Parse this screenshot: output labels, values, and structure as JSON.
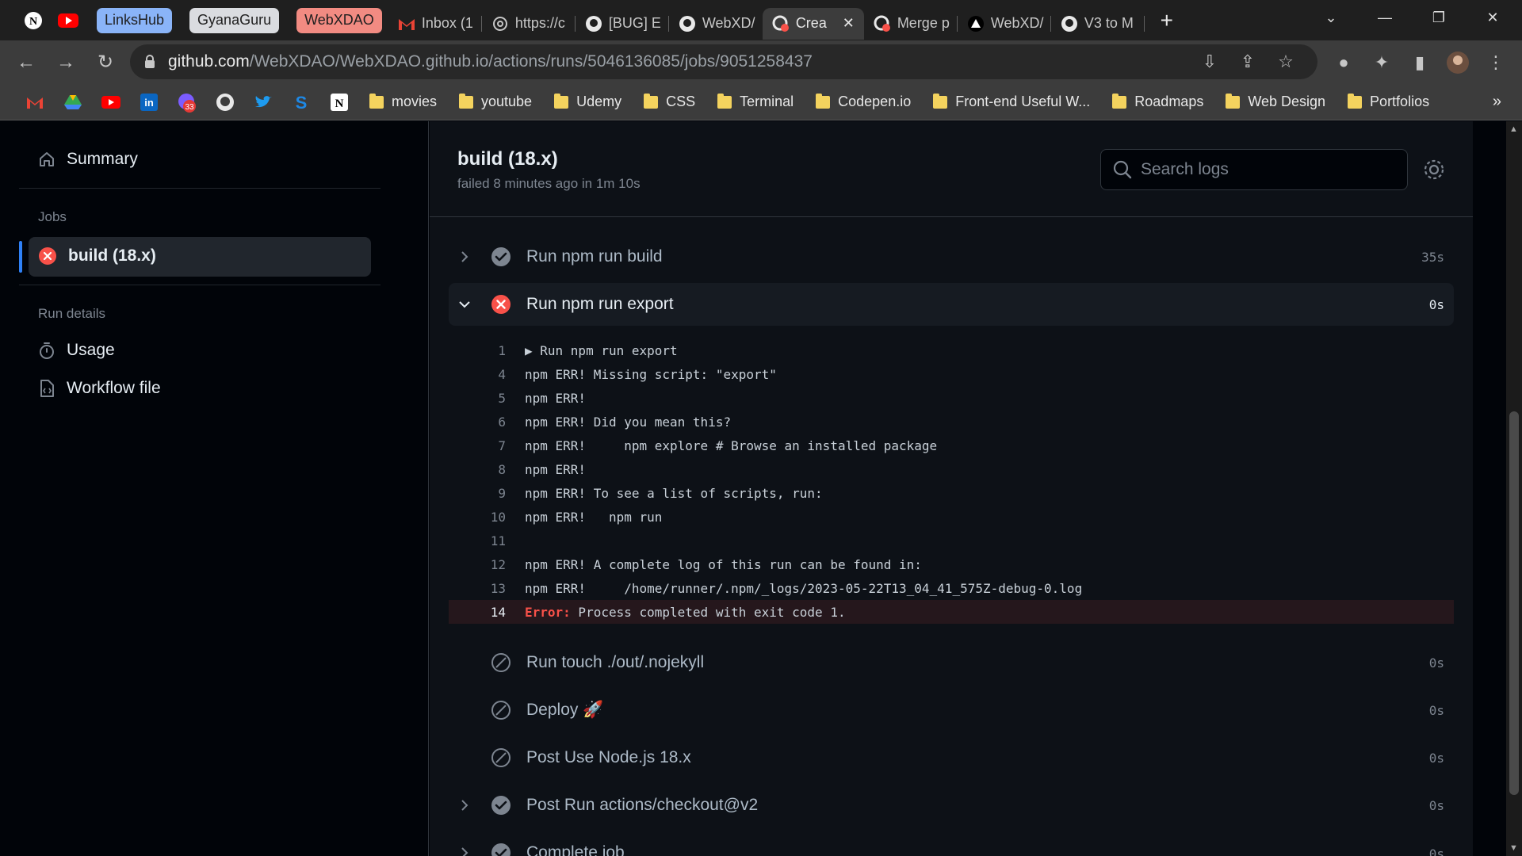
{
  "browser": {
    "groups": [
      "LinksHub",
      "GyanaGuru",
      "WebXDAO"
    ],
    "group_colors": [
      "#8ab4f8",
      "#dadce0",
      "#f28b82"
    ],
    "tabs": [
      {
        "label": "Inbox (1",
        "icon": "gmail-icon"
      },
      {
        "label": "https://c",
        "icon": "chatgpt-icon"
      },
      {
        "label": "[BUG] E",
        "icon": "github-icon"
      },
      {
        "label": "WebXD/",
        "icon": "github-icon"
      },
      {
        "label": "Crea",
        "icon": "github-actions-failed-icon",
        "active": true
      },
      {
        "label": "Merge p",
        "icon": "github-actions-failed-icon"
      },
      {
        "label": "WebXD/",
        "icon": "vercel-icon"
      },
      {
        "label": "V3 to M",
        "icon": "github-icon"
      }
    ],
    "url_host": "github.com",
    "url_path": "/WebXDAO/WebXDAO.github.io/actions/runs/5046136085/jobs/9051258437",
    "bookmarks": [
      "movies",
      "youtube",
      "Udemy",
      "CSS",
      "Terminal",
      "Codepen.io",
      "Front-end Useful W...",
      "Roadmaps",
      "Web Design",
      "Portfolios"
    ],
    "notif_badge": "33"
  },
  "sidebar": {
    "summary": "Summary",
    "jobs_heading": "Jobs",
    "job": "build (18.x)",
    "run_details_heading": "Run details",
    "usage": "Usage",
    "workflow_file": "Workflow file"
  },
  "main": {
    "title": "build (18.x)",
    "subtitle": "failed 8 minutes ago in 1m 10s",
    "search_placeholder": "Search logs",
    "steps_top": [
      {
        "name": "Run npm run build",
        "duration": "35s",
        "status": "success"
      },
      {
        "name": "Run npm run export",
        "duration": "0s",
        "status": "failed"
      }
    ],
    "log": [
      {
        "n": "1",
        "text": "▶ Run npm run export"
      },
      {
        "n": "4",
        "text": "npm ERR! Missing script: \"export\""
      },
      {
        "n": "5",
        "text": "npm ERR!"
      },
      {
        "n": "6",
        "text": "npm ERR! Did you mean this?"
      },
      {
        "n": "7",
        "text": "npm ERR!     npm explore # Browse an installed package"
      },
      {
        "n": "8",
        "text": "npm ERR!"
      },
      {
        "n": "9",
        "text": "npm ERR! To see a list of scripts, run:"
      },
      {
        "n": "10",
        "text": "npm ERR!   npm run"
      },
      {
        "n": "11",
        "text": ""
      },
      {
        "n": "12",
        "text": "npm ERR! A complete log of this run can be found in:"
      },
      {
        "n": "13",
        "text": "npm ERR!     /home/runner/.npm/_logs/2023-05-22T13_04_41_575Z-debug-0.log"
      }
    ],
    "error_line": {
      "n": "14",
      "keyword": "Error:",
      "text": " Process completed with exit code 1."
    },
    "steps_bottom": [
      {
        "name": "Run touch ./out/.nojekyll",
        "duration": "0s",
        "status": "skipped"
      },
      {
        "name": "Deploy 🚀",
        "duration": "0s",
        "status": "skipped"
      },
      {
        "name": "Post Use Node.js 18.x",
        "duration": "0s",
        "status": "skipped"
      },
      {
        "name": "Post Run actions/checkout@v2",
        "duration": "0s",
        "status": "success"
      },
      {
        "name": "Complete job",
        "duration": "0s",
        "status": "success"
      }
    ]
  },
  "colors": {
    "accent": "#2f81f7",
    "danger": "#f85149",
    "success": "#7d8590"
  }
}
